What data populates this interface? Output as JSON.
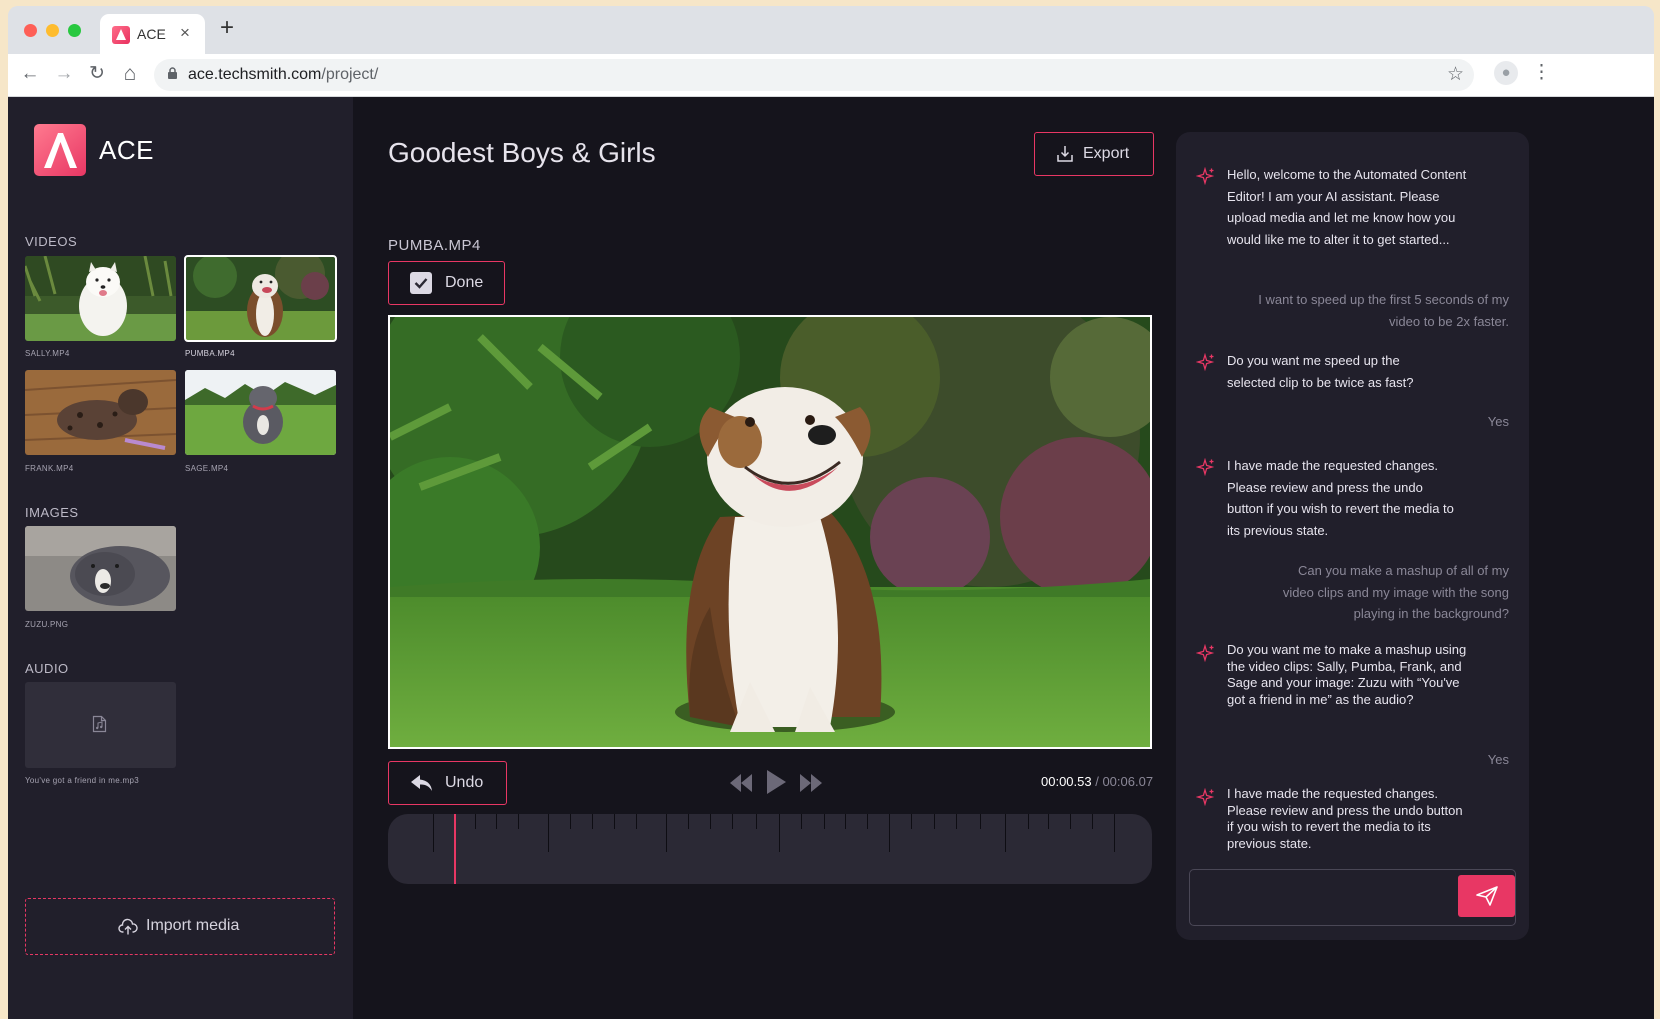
{
  "browser": {
    "tab_title": "ACE",
    "tab_close": "×",
    "new_tab": "+",
    "url_host": "ace.techsmith.com",
    "url_path": "/project/",
    "nav": {
      "back": "←",
      "forward": "→",
      "reload": "↻",
      "home": "⌂"
    },
    "star": "☆",
    "menu": "⋮"
  },
  "app": {
    "name": "ACE",
    "sidebar": {
      "videos_title": "VIDEOS",
      "videos": [
        {
          "label": "SALLY.MP4",
          "selected": false
        },
        {
          "label": "PUMBA.MP4",
          "selected": true
        },
        {
          "label": "FRANK.MP4",
          "selected": false
        },
        {
          "label": "SAGE.MP4",
          "selected": false
        }
      ],
      "images_title": "IMAGES",
      "images": [
        {
          "label": "ZUZU.PNG"
        }
      ],
      "audio_title": "AUDIO",
      "audio": [
        {
          "label": "You've got a friend in me.mp3"
        }
      ],
      "import_label": "Import media"
    },
    "main": {
      "project_title": "Goodest Boys & Girls",
      "export_label": "Export",
      "clip_name": "PUMBA.MP4",
      "done_label": "Done",
      "undo_label": "Undo",
      "time_current": "00:00.53",
      "time_separator": " / ",
      "time_total": "00:06.07",
      "playhead_fraction": 0.087
    },
    "chat": {
      "messages": [
        {
          "from": "ai",
          "text": "Hello, welcome to the Automated Content Editor! I am your AI assistant. Please upload media and let me know how you would like me to alter it to get started..."
        },
        {
          "from": "user",
          "text": "I want to speed up the first 5 seconds of my video to be 2x faster."
        },
        {
          "from": "ai",
          "text": "Do you want me speed up the selected clip to be twice as fast?"
        },
        {
          "from": "user",
          "text": "Yes"
        },
        {
          "from": "ai",
          "text": "I have made the requested changes. Please review and press the undo button if you wish to revert the media to its previous state."
        },
        {
          "from": "user",
          "text": "Can you make a mashup of all of my video clips and my image with the song playing in the background?"
        },
        {
          "from": "ai",
          "text": "Do you want me to make a mashup using the video clips: Sally, Pumba, Frank, and Sage and your image: Zuzu with “You've got a friend in me” as the audio?"
        },
        {
          "from": "user",
          "text": "Yes"
        },
        {
          "from": "ai",
          "text": "I have made the requested changes. Please review and press the undo button if you wish to revert the media to its previous state."
        }
      ],
      "input_value": ""
    }
  },
  "colors": {
    "accent": "#e83764",
    "panel": "#211f2b",
    "background": "#15141c"
  }
}
